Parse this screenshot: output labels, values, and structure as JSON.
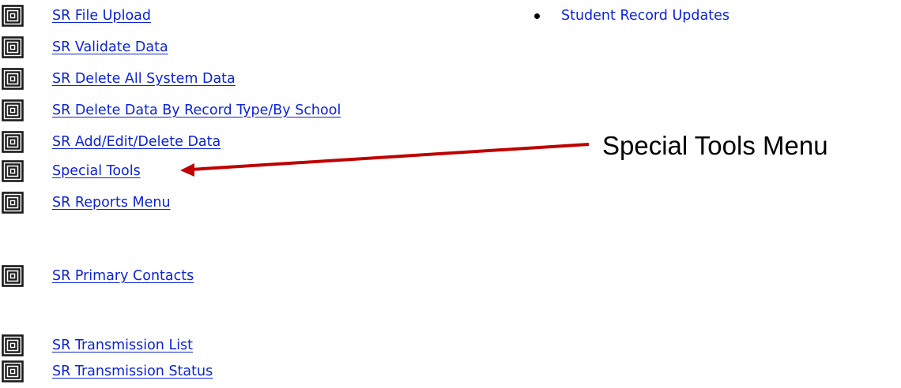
{
  "menu": {
    "items": [
      {
        "label": "SR File Upload",
        "icon": "square-spiral-icon"
      },
      {
        "label": "SR Validate Data",
        "icon": "square-spiral-icon"
      },
      {
        "label": "SR Delete All System Data",
        "icon": "square-spiral-icon"
      },
      {
        "label": "SR Delete Data By Record Type/By School",
        "icon": "square-spiral-icon"
      },
      {
        "label": "SR Add/Edit/Delete Data",
        "icon": "square-spiral-icon"
      },
      {
        "label": "Special Tools",
        "icon": "square-spiral-icon"
      },
      {
        "label": "SR Reports Menu",
        "icon": "square-spiral-icon"
      },
      {
        "label": "SR Primary Contacts",
        "icon": "square-spiral-icon"
      },
      {
        "label": "SR Transmission List",
        "icon": "square-spiral-icon"
      },
      {
        "label": "SR Transmission Status",
        "icon": "square-spiral-icon"
      }
    ]
  },
  "bullet_list": {
    "items": [
      {
        "label": "Student Record Updates"
      }
    ]
  },
  "annotation": {
    "text": "Special Tools Menu",
    "arrow_color": "#c00000"
  },
  "colors": {
    "link": "#0b24d6",
    "text": "#000000"
  }
}
